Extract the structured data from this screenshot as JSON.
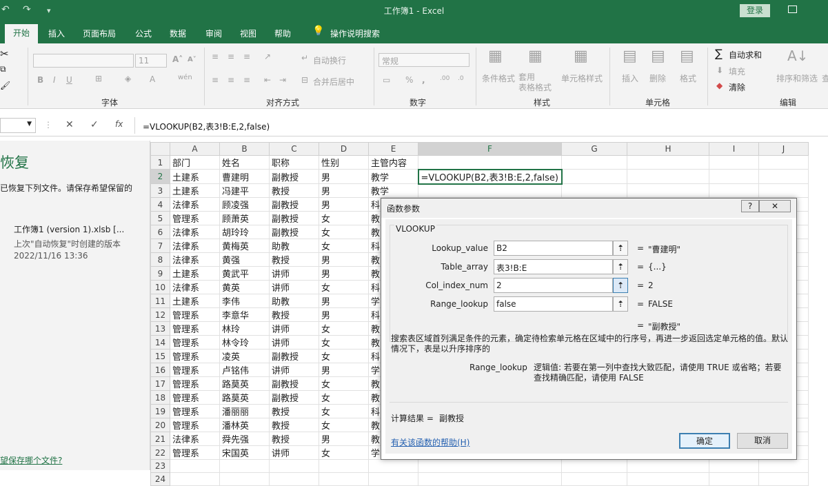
{
  "titlebar": {
    "title": "工作簿1  -  Excel",
    "login": "登录",
    "qat": [
      "↶",
      "↷",
      "▾"
    ]
  },
  "tabs": [
    "开始",
    "插入",
    "页面布局",
    "公式",
    "数据",
    "审阅",
    "视图",
    "帮助",
    "操作说明搜索"
  ],
  "ribbon": {
    "font_size": "11",
    "groups": [
      "字体",
      "对齐方式",
      "数字",
      "样式",
      "单元格",
      "编辑"
    ],
    "wrap_text": "自动换行",
    "merge_center": "合并后居中",
    "number_format": "常规",
    "conditional_format": "条件格式",
    "table_format": "套用\n表格格式",
    "cell_style": "单元格样式",
    "insert": "插入",
    "delete": "删除",
    "format": "格式",
    "autosum": "自动求和",
    "fill": "填充",
    "clear": "清除",
    "sort_filter": "排序和筛选",
    "find": "查"
  },
  "formula_bar": {
    "fx": "fx",
    "formula": "=VLOOKUP(B2,表3!B:E,2,false)"
  },
  "recovery": {
    "title": "恢复",
    "desc": "已恢复下列文件。请保存希望保留的",
    "file_name": "工作簿1 (version 1).xlsb  [...",
    "file_desc": "上次\"自动恢复\"时创建的版本",
    "file_time": "2022/11/16 13:36",
    "link": "望保存哪个文件?"
  },
  "sheet": {
    "columns": [
      "A",
      "B",
      "C",
      "D",
      "E",
      "F",
      "G",
      "H",
      "I",
      "J"
    ],
    "rows": [
      [
        "部门",
        "姓名",
        "职称",
        "性别",
        "主管内容"
      ],
      [
        "土建系",
        "曹建明",
        "副教授",
        "男",
        "教学"
      ],
      [
        "土建系",
        "冯建平",
        "教授",
        "男",
        "教学"
      ],
      [
        "法律系",
        "顾凌强",
        "副教授",
        "男",
        "科"
      ],
      [
        "管理系",
        "顾萧英",
        "副教授",
        "女",
        "教"
      ],
      [
        "法律系",
        "胡玲玲",
        "副教授",
        "女",
        "教"
      ],
      [
        "法律系",
        "黄梅英",
        "助教",
        "女",
        "科"
      ],
      [
        "法律系",
        "黄强",
        "教授",
        "男",
        "教"
      ],
      [
        "土建系",
        "黄武平",
        "讲师",
        "男",
        "教"
      ],
      [
        "法律系",
        "黄英",
        "讲师",
        "女",
        "科"
      ],
      [
        "土建系",
        "李伟",
        "助教",
        "男",
        "学"
      ],
      [
        "管理系",
        "李意华",
        "教授",
        "男",
        "科"
      ],
      [
        "管理系",
        "林玲",
        "讲师",
        "女",
        "教"
      ],
      [
        "管理系",
        "林令玲",
        "讲师",
        "女",
        "教"
      ],
      [
        "管理系",
        "凌英",
        "副教授",
        "女",
        "科"
      ],
      [
        "管理系",
        "卢铭伟",
        "讲师",
        "男",
        "学"
      ],
      [
        "管理系",
        "路莫英",
        "副教授",
        "女",
        "教"
      ],
      [
        "管理系",
        "路莫英",
        "副教授",
        "女",
        "教"
      ],
      [
        "管理系",
        "潘丽丽",
        "教授",
        "女",
        "科"
      ],
      [
        "管理系",
        "潘林英",
        "教授",
        "女",
        "教"
      ],
      [
        "法律系",
        "舜先强",
        "教授",
        "男",
        "教"
      ],
      [
        "管理系",
        "宋国英",
        "讲师",
        "女",
        "学"
      ],
      [
        "",
        "",
        "",
        "",
        ""
      ],
      [
        "",
        "",
        "",
        "",
        ""
      ]
    ],
    "editing_cell": "=VLOOKUP(B2,表3!B:E,2,false)"
  },
  "dialog": {
    "title": "函数参数",
    "function": "VLOOKUP",
    "args": [
      {
        "label": "Lookup_value",
        "value": "B2",
        "result": "\"曹建明\""
      },
      {
        "label": "Table_array",
        "value": "表3!B:E",
        "result": "{...}"
      },
      {
        "label": "Col_index_num",
        "value": "2",
        "result": "2"
      },
      {
        "label": "Range_lookup",
        "value": "false",
        "result": "FALSE"
      }
    ],
    "overall_result": "\"副教授\"",
    "description": "搜索表区域首列满足条件的元素，确定待检索单元格在区域中的行序号，再进一步返回选定单元格的值。默认情况下，表是以升序排序的",
    "arg_help_name": "Range_lookup",
    "arg_help_text": "逻辑值: 若要在第一列中查找大致匹配，请使用 TRUE 或省略；若要查找精确匹配，请使用 FALSE",
    "calc_label": "计算结果 =",
    "calc_value": "副教授",
    "help_link": "有关该函数的帮助(H)",
    "ok": "确定",
    "cancel": "取消"
  }
}
